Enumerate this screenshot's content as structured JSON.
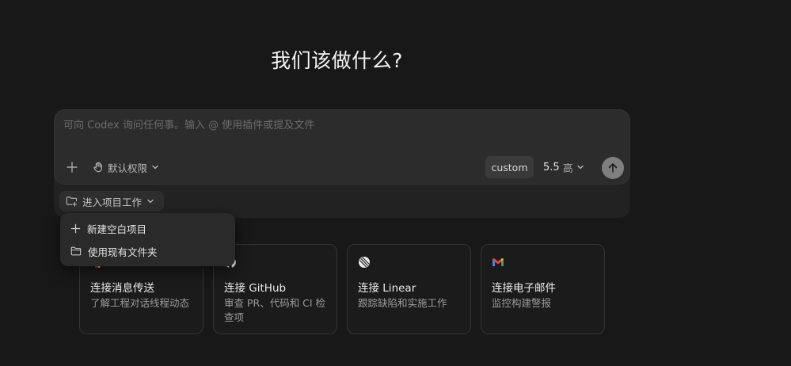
{
  "hero": {
    "title": "我们该做什么?"
  },
  "composer": {
    "placeholder": "可向 Codex 询问任何事。输入 @ 使用插件或提及文件",
    "permission_label": "默认权限",
    "custom_label": "custom",
    "model_version": "5.5",
    "model_effort": "高"
  },
  "project": {
    "label": "进入项目工作"
  },
  "dropdown": {
    "items": [
      {
        "label": "新建空白项目",
        "icon": "plus-icon"
      },
      {
        "label": "使用现有文件夹",
        "icon": "folder-icon"
      }
    ]
  },
  "cards": [
    {
      "title": "连接消息传送",
      "desc": "了解工程对话线程动态",
      "icon": "slack-icon"
    },
    {
      "title": "连接 GitHub",
      "desc": "审查 PR、代码和 CI 检查项",
      "icon": "github-icon"
    },
    {
      "title": "连接 Linear",
      "desc": "跟踪缺陷和实施工作",
      "icon": "linear-icon"
    },
    {
      "title": "连接电子邮件",
      "desc": "监控构建警报",
      "icon": "gmail-icon"
    }
  ],
  "colors": {
    "background": "#181818",
    "composer": "#2c2c2c",
    "send_button": "#7f7f7f",
    "gmail_red": "#ea4335",
    "gmail_blue": "#4285f4",
    "gmail_green": "#34a853",
    "gmail_yellow": "#fbbc05"
  }
}
